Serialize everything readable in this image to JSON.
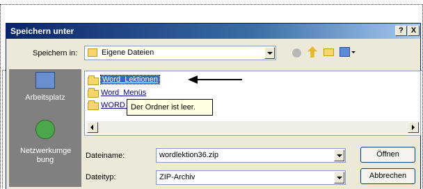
{
  "dialog": {
    "title": "Speichern unter",
    "help_button": "?",
    "close_button": "X"
  },
  "location": {
    "label": "Speichern in:",
    "value": "Eigene Dateien"
  },
  "places": [
    {
      "label": "Arbeitsplatz"
    },
    {
      "label": "Netzwerkumge bung"
    }
  ],
  "files": [
    {
      "name": "Word_Lektionen"
    },
    {
      "name": "Word_Menüs"
    },
    {
      "name": "WORD_"
    }
  ],
  "tooltip": "Der Ordner ist leer.",
  "filename": {
    "label": "Dateiname:",
    "value": "wordlektion36.zip"
  },
  "filetype": {
    "label": "Dateityp:",
    "value": "ZIP-Archiv"
  },
  "buttons": {
    "open": "Öffnen",
    "cancel": "Abbrechen"
  },
  "colors": {
    "title_bar": "#0a246a",
    "dialog_bg": "#ece9d8",
    "places_bg": "#808080",
    "link": "#00008b"
  }
}
